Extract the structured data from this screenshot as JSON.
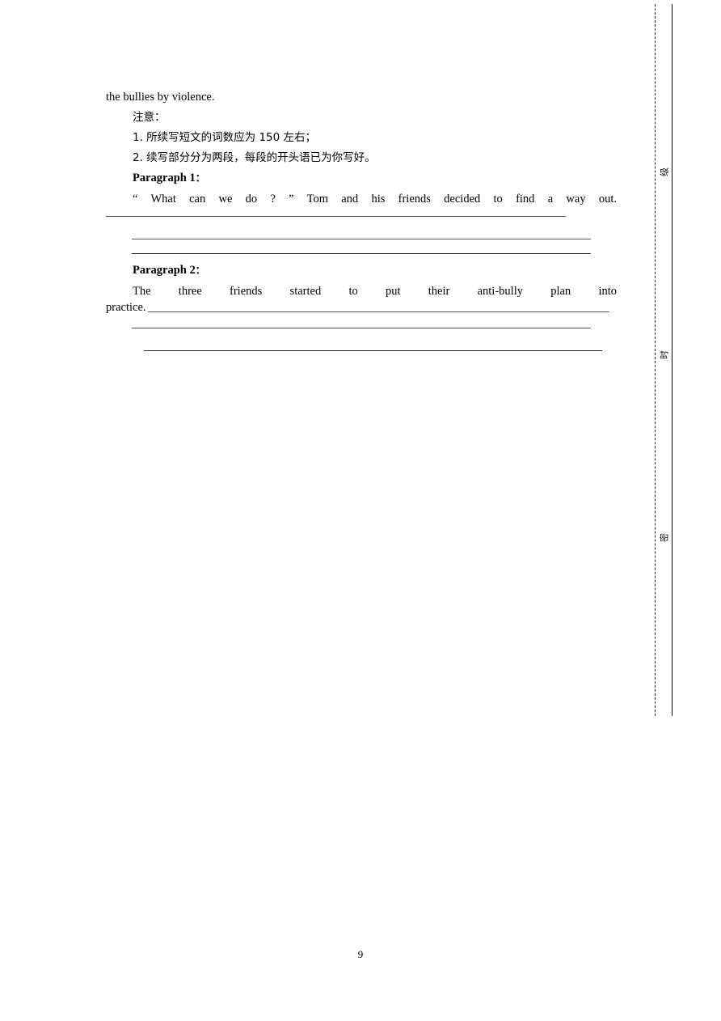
{
  "document": {
    "page_number": "9",
    "body_text": "the bullies by violence.",
    "notes_heading": "注意：",
    "notes": [
      "1. 所续写短文的词数应为 150  左右；",
      "2. 续写部分分为两段，每段的开头语已为你写好。"
    ],
    "paragraphs": [
      {
        "label": "Paragraph 1",
        "colon": "：",
        "starter_line1": "“  What  can  we  do ?  ”  Tom  and  his  friends  decided  to  find  a  way  out.",
        "starter_line2": "",
        "continuation_word": ""
      },
      {
        "label": "Paragraph 2",
        "colon": "：",
        "starter_line1": "The  three  friends  started  to  put  their  anti-bully  plan  into",
        "starter_line2": "",
        "continuation_word": "practice."
      }
    ]
  },
  "seal_line": {
    "characters": [
      "级",
      "时",
      "密"
    ],
    "dashed_color": "#222222",
    "solid_color": "#000000"
  },
  "colors": {
    "page_background": "#ffffff",
    "text": "#000000",
    "rule_light": "#555555",
    "rule_dark": "#222222"
  }
}
